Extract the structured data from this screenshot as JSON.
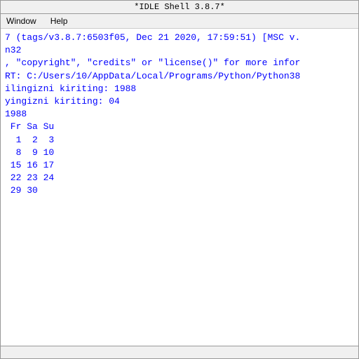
{
  "titleBar": {
    "label": "*IDLE Shell 3.8.7*"
  },
  "menuBar": {
    "items": [
      "Window",
      "Help"
    ]
  },
  "shell": {
    "lines": [
      "7 (tags/v3.8.7:6503f05, Dec 21 2020, 17:59:51) [MSC v.",
      "n32",
      ", \"copyright\", \"credits\" or \"license()\" for more infor",
      "",
      "RT: C:/Users/10/AppData/Local/Programs/Python/Python38",
      "ilingizni kiriting: 1988",
      "yingizni kiriting: 04",
      "1988",
      " Fr Sa Su",
      "  1  2  3",
      "  8  9 10",
      " 15 16 17",
      " 22 23 24",
      " 29 30"
    ]
  },
  "statusBar": {
    "label": ""
  }
}
